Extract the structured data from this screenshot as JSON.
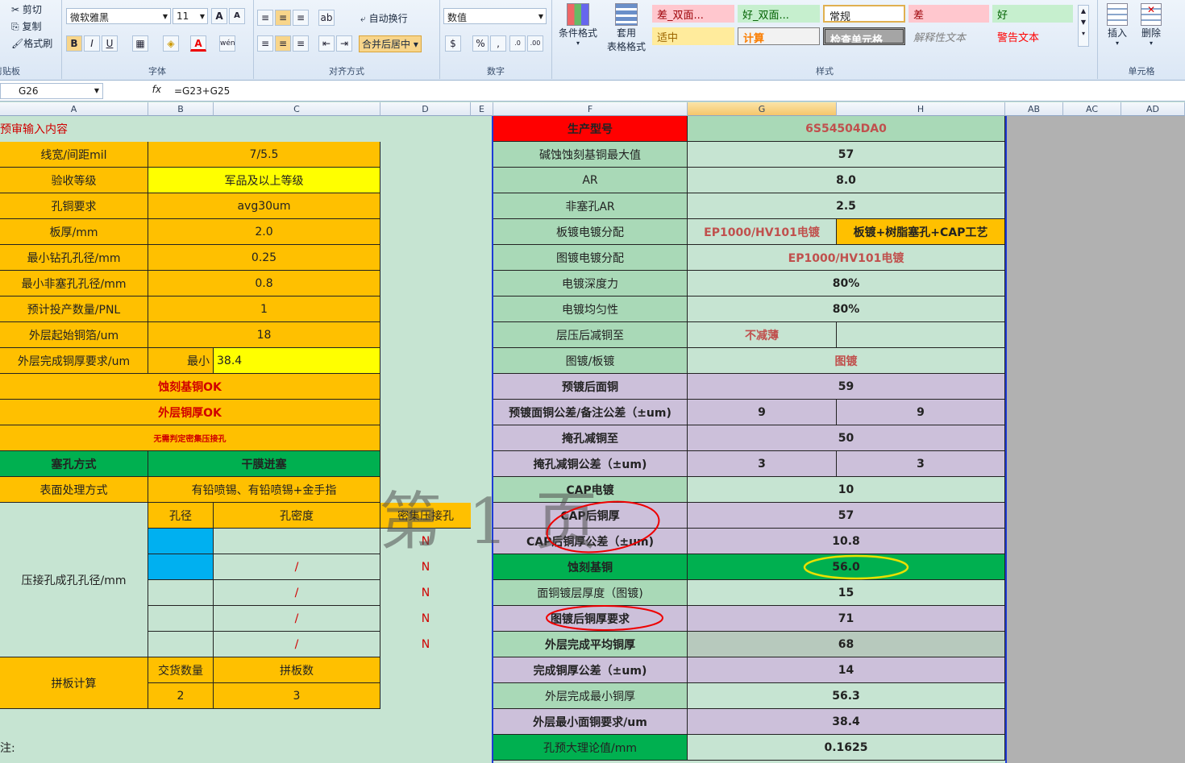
{
  "ribbon": {
    "clipboard": {
      "cut": "剪切",
      "copy": "复制",
      "format_painter": "格式刷",
      "group": "剪贴板"
    },
    "font": {
      "name": "微软雅黑",
      "size": "11",
      "group": "字体",
      "bold": "B",
      "italic": "I",
      "underline": "U",
      "grow": "A",
      "shrink": "A",
      "color_a": "A",
      "wen": "wén"
    },
    "alignment": {
      "wrap": "自动换行",
      "merge": "合并后居中",
      "group": "对齐方式"
    },
    "number": {
      "format": "数值",
      "group": "数字",
      "percent": "%",
      "comma": ","
    },
    "styles": {
      "conditional": "条件格式",
      "table_1": "套用",
      "table_2": "表格格式",
      "group": "样式",
      "cells": [
        "差_双面...",
        "好_双面...",
        "常规",
        "差",
        "好",
        "适中",
        "计算",
        "检查单元格",
        "解释性文本",
        "警告文本"
      ]
    },
    "cells_group": {
      "insert": "插入",
      "delete": "删除",
      "group": "单元格"
    }
  },
  "formula_bar": {
    "name_box": "G26",
    "fx": "fx",
    "formula": "=G23+G25"
  },
  "columns": [
    "A",
    "B",
    "C",
    "D",
    "E",
    "F",
    "G",
    "H",
    "AB",
    "AC",
    "AD"
  ],
  "left": {
    "title": "预审输入内容",
    "rows": [
      {
        "label": "线宽/间距mil",
        "value": "7/5.5"
      },
      {
        "label": "验收等级",
        "value": "军品及以上等级"
      },
      {
        "label": "孔铜要求",
        "value": "avg30um"
      },
      {
        "label": "板厚/mm",
        "value": "2.0"
      },
      {
        "label": "最小钻孔孔径/mm",
        "value": "0.25"
      },
      {
        "label": "最小非塞孔孔径/mm",
        "value": "0.8"
      },
      {
        "label": "预计投产数量/PNL",
        "value": "1"
      },
      {
        "label": "外层起始铜箔/um",
        "value": "18"
      }
    ],
    "outer_req": {
      "label": "外层完成铜厚要求/um",
      "min_label": "最小",
      "min_value": "38.4"
    },
    "etch_ok": "蚀刻基铜OK",
    "outer_ok": "外层铜厚OK",
    "no_need": "无需判定密集压接孔",
    "plug": {
      "label": "塞孔方式",
      "value": "干膜迸塞"
    },
    "surface": {
      "label": "表面处理方式",
      "value": "有铅喷锡、有铅喷锡+金手指"
    },
    "press": {
      "label": "压接孔成孔孔径/mm",
      "h_hole": "孔径",
      "h_density": "孔密度",
      "h_dense": "密集压接孔",
      "rows": [
        {
          "d": "",
          "n": "N"
        },
        {
          "d": "/",
          "n": "N"
        },
        {
          "d": "/",
          "n": "N"
        },
        {
          "d": "/",
          "n": "N"
        },
        {
          "d": "/",
          "n": "N"
        }
      ]
    },
    "panel": {
      "label": "拼板计算",
      "h_qty": "交货数量",
      "h_count": "拼板数",
      "qty": "2",
      "count": "3"
    },
    "note": "注:"
  },
  "watermark": "第 1 页",
  "right": {
    "model": {
      "label": "生产型号",
      "value": "6S54504DA0"
    },
    "rows": [
      {
        "label": "碱蚀蚀刻基铜最大值",
        "g": "57"
      },
      {
        "label": "AR",
        "g": "8.0"
      },
      {
        "label": "非塞孔AR",
        "g": "2.5"
      },
      {
        "label": "板镀电镀分配",
        "g": "EP1000/HV101电镀",
        "h": "板镀+树脂塞孔+CAP工艺"
      },
      {
        "label": "图镀电镀分配",
        "g": "EP1000/HV101电镀"
      },
      {
        "label": "电镀深度力",
        "g": "80%"
      },
      {
        "label": "电镀均匀性",
        "g": "80%"
      },
      {
        "label": "层压后减铜至",
        "g": "不减薄",
        "h": ""
      },
      {
        "label": "图镀/板镀",
        "g": "图镀"
      },
      {
        "label": "预镀后面铜",
        "g": "59"
      },
      {
        "label": "预镀面铜公差/备注公差（±um)",
        "g": "9",
        "h": "9"
      },
      {
        "label": "掩孔减铜至",
        "g": "50"
      },
      {
        "label": "掩孔减铜公差（±um)",
        "g": "3",
        "h": "3"
      },
      {
        "label": "CAP电镀",
        "g": "10"
      },
      {
        "label": "CAP后铜厚",
        "g": "57"
      },
      {
        "label": "CAP后铜厚公差（±um)",
        "g": "10.8"
      },
      {
        "label": "蚀刻基铜",
        "g": "56.0"
      },
      {
        "label": "面铜镀层厚度（图镀)",
        "g": "15"
      },
      {
        "label": "图镀后铜厚要求",
        "g": "71"
      },
      {
        "label": "外层完成平均铜厚",
        "g": "68"
      },
      {
        "label": "完成铜厚公差（±um)",
        "g": "14"
      },
      {
        "label": "外层完成最小铜厚",
        "g": "56.3"
      },
      {
        "label": "外层最小面铜要求/um",
        "g": "38.4"
      },
      {
        "label": "孔预大理论值/mm",
        "g": "0.1625"
      }
    ]
  },
  "colors": {
    "orange": "#ffc000",
    "yellow": "#ffff00",
    "green": "#00b050",
    "lavender": "#ccc0da",
    "red": "#ff0000",
    "mint": "#c6e4d2"
  }
}
